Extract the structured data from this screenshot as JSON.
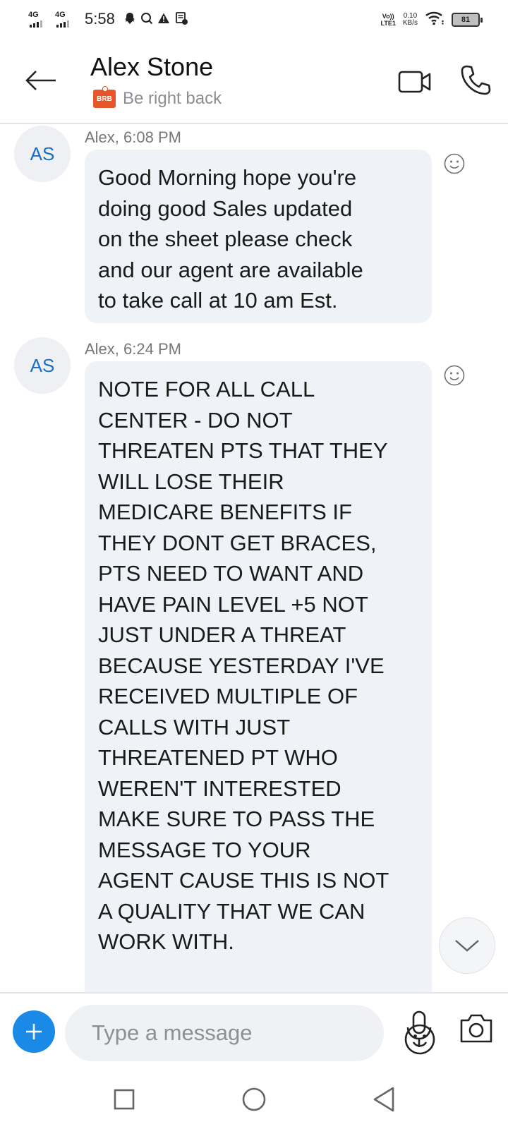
{
  "status_bar": {
    "network_1": "4G",
    "network_2": "4G",
    "time": "5:58",
    "volte_line1": "Vo))",
    "volte_line2": "LTE1",
    "data_speed_value": "0.10",
    "data_speed_unit": "KB/s",
    "battery_level": "81"
  },
  "header": {
    "contact_name": "Alex Stone",
    "presence_badge": "BRB",
    "presence_text": "Be right back"
  },
  "messages": [
    {
      "avatar": "AS",
      "meta": "Alex, 6:08 PM",
      "text": "Good Morning hope you're\ndoing good Sales updated\non the sheet please check\nand our agent are available\nto take call at 10 am Est."
    },
    {
      "avatar": "AS",
      "meta": "Alex, 6:24 PM",
      "text": "NOTE FOR ALL CALL\nCENTER - DO NOT\nTHREATEN PTS THAT THEY\nWILL LOSE THEIR\nMEDICARE BENEFITS IF\nTHEY DONT GET BRACES,\nPTS NEED TO WANT AND\nHAVE PAIN LEVEL +5 NOT\nJUST UNDER A THREAT\nBECAUSE YESTERDAY I'VE\nRECEIVED MULTIPLE OF\nCALLS WITH JUST\nTHREATENED PT WHO\nWEREN'T INTERESTED\nMAKE SURE TO PASS THE\nMESSAGE TO YOUR\nAGENT CAUSE THIS IS NOT\nA QUALITY THAT WE CAN\nWORK WITH."
    }
  ],
  "composer": {
    "placeholder": "Type a message",
    "value": ""
  },
  "icons": {
    "back": "arrow-left-icon",
    "video_call": "video-camera-icon",
    "voice_call": "phone-icon",
    "react": "smiley-icon",
    "scroll_down": "chevron-down-icon",
    "add": "plus-icon",
    "emoji": "emoji-icon",
    "mic": "microphone-icon",
    "camera": "camera-icon",
    "nav_recents": "square-icon",
    "nav_home": "circle-icon",
    "nav_back": "triangle-back-icon"
  },
  "colors": {
    "accent": "#1a8ae6",
    "avatar_text": "#1a6fc4",
    "bubble_bg": "#eff2f6",
    "brb_badge": "#e8542a"
  }
}
